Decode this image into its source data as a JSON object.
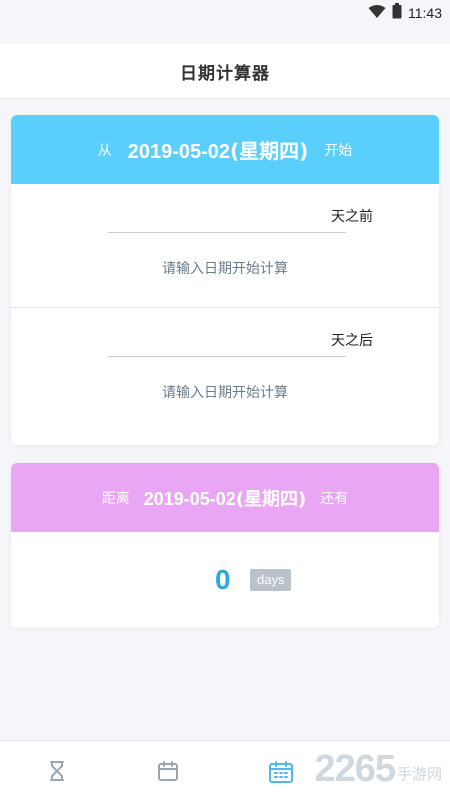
{
  "status_bar": {
    "time": "11:43",
    "icons": [
      "wifi-icon",
      "battery-icon"
    ]
  },
  "app": {
    "title": "日期计算器"
  },
  "calc_card": {
    "prefix": "从",
    "date": "2019-05-02",
    "weekday": "(星期四)",
    "suffix": "开始",
    "header_color": "#5bcffb",
    "before": {
      "unit": "天之前",
      "input_value": "",
      "result": "请输入日期开始计算"
    },
    "after": {
      "unit": "天之后",
      "input_value": "",
      "result": "请输入日期开始计算"
    }
  },
  "countdown_card": {
    "prefix": "距离",
    "date": "2019-05-02",
    "weekday": "(星期四)",
    "suffix": "还有",
    "header_color": "#e9a6f4",
    "value": "0",
    "unit": "days"
  },
  "tab_bar": {
    "tabs": [
      {
        "icon": "hourglass-icon",
        "active": false
      },
      {
        "icon": "calendar-icon",
        "active": false
      },
      {
        "icon": "calculator-calendar-icon",
        "active": true
      }
    ],
    "active_color": "#4fb8f0",
    "inactive_color": "#9aa7b2"
  },
  "watermark": {
    "number": "2265",
    "text": "手游网"
  }
}
